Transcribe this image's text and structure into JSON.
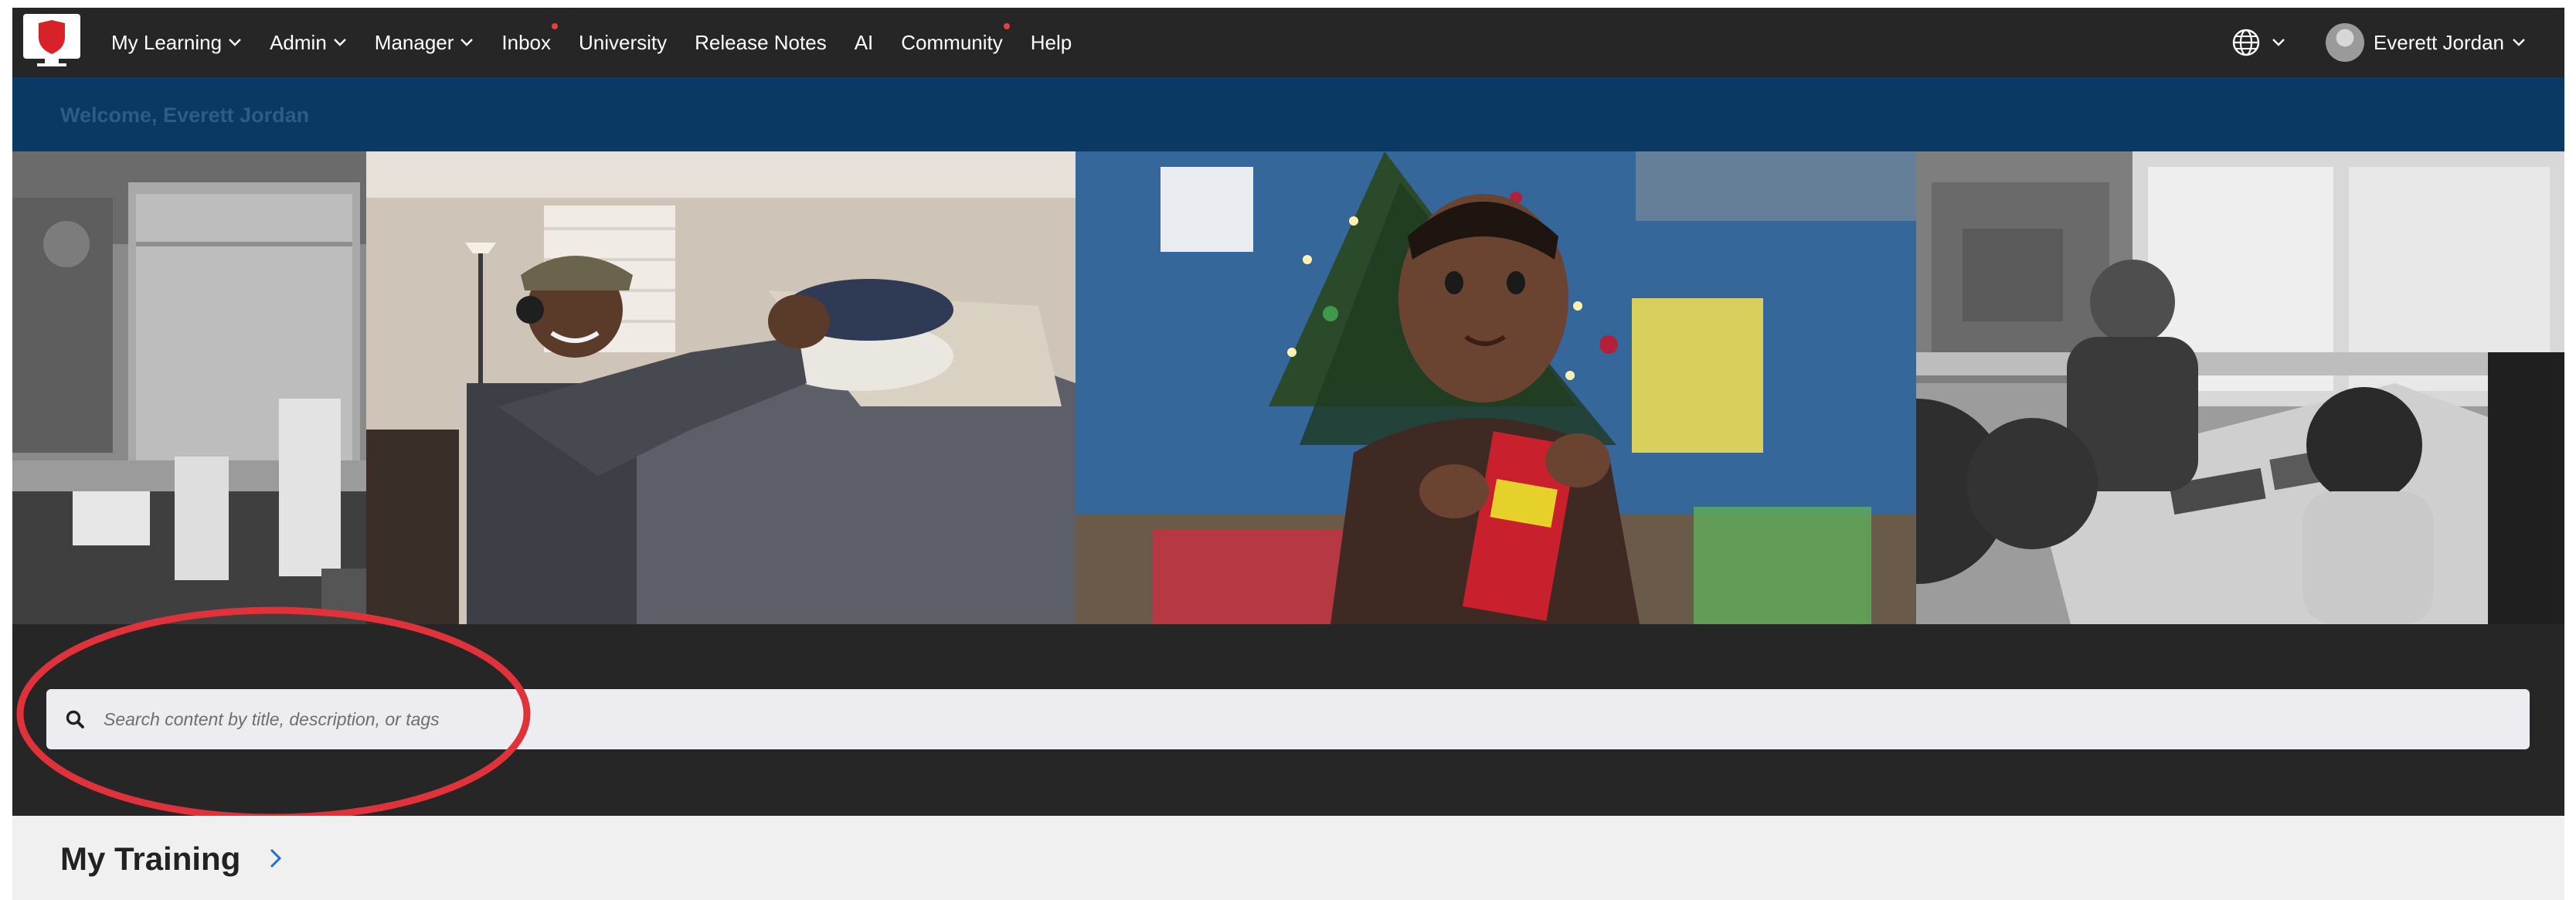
{
  "nav": {
    "items": [
      {
        "label": "My Learning",
        "has_dropdown": true,
        "notification": false
      },
      {
        "label": "Admin",
        "has_dropdown": true,
        "notification": false
      },
      {
        "label": "Manager",
        "has_dropdown": true,
        "notification": false
      },
      {
        "label": "Inbox",
        "has_dropdown": false,
        "notification": true
      },
      {
        "label": "University",
        "has_dropdown": false,
        "notification": false
      },
      {
        "label": "Release Notes",
        "has_dropdown": false,
        "notification": false
      },
      {
        "label": "AI",
        "has_dropdown": false,
        "notification": false
      },
      {
        "label": "Community",
        "has_dropdown": false,
        "notification": true
      },
      {
        "label": "Help",
        "has_dropdown": false,
        "notification": false
      }
    ],
    "language_icon": "globe-icon",
    "user_name": "Everett Jordan"
  },
  "welcome": {
    "text": "Welcome, Everett Jordan"
  },
  "search": {
    "placeholder": "Search content by title, description, or tags",
    "icon": "search-icon"
  },
  "my_training": {
    "title": "My Training"
  },
  "colors": {
    "nav_bg": "#262626",
    "welcome_bg": "#0a3a63",
    "annotation": "#e0323a",
    "notification_dot": "#e8413b",
    "chevron_blue": "#1f6fd1"
  }
}
